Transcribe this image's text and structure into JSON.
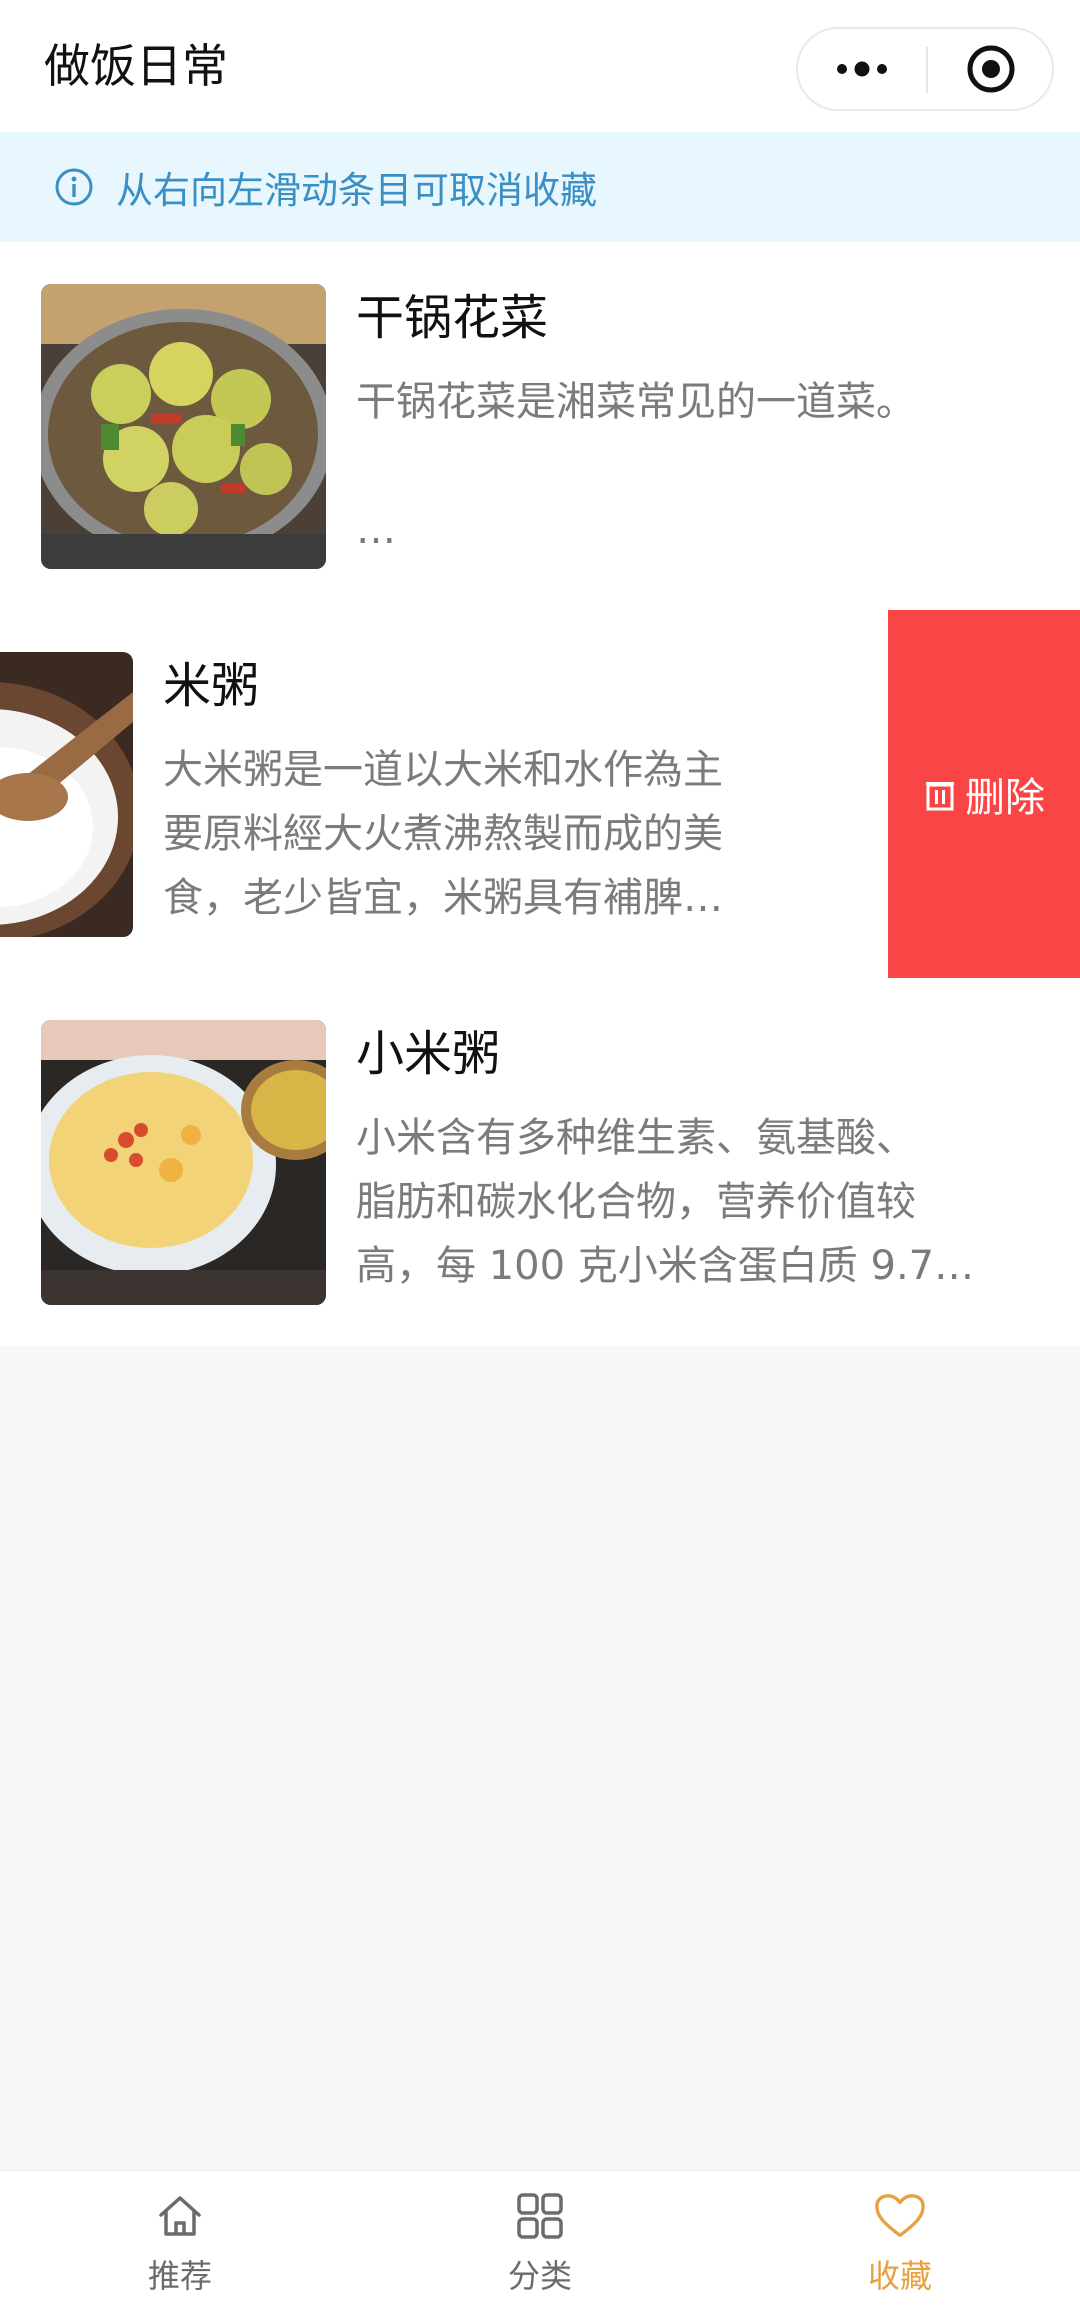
{
  "navbar": {
    "title": "做饭日常"
  },
  "notice": {
    "text": "从右向左滑动条目可取消收藏",
    "icon": "info-icon"
  },
  "favorites": [
    {
      "title": "干锅花菜",
      "desc_lines": [
        "干锅花菜是湘菜常见的一道菜。",
        "",
        "…"
      ]
    },
    {
      "title": "米粥",
      "desc_lines": [
        "大米粥是一道以大米和水作為主",
        "要原料經大火煮沸熬製而成的美",
        "食，老少皆宜，米粥具有補脾…"
      ],
      "swiped": true,
      "delete_label": "删除"
    },
    {
      "title": "小米粥",
      "desc_lines": [
        "小米含有多种维生素、氨基酸、",
        "脂肪和碳水化合物，营养价值较",
        "高，每 100 克小米含蛋白质 9.7…"
      ]
    }
  ],
  "tabbar": {
    "tabs": [
      {
        "label": "推荐",
        "icon": "home-icon",
        "active": false
      },
      {
        "label": "分类",
        "icon": "grid-icon",
        "active": false
      },
      {
        "label": "收藏",
        "icon": "heart-icon",
        "active": true
      }
    ]
  },
  "colors": {
    "accent": "#e8a040",
    "delete": "#fa4547",
    "notice_bg": "#e8f6fd",
    "notice_text": "#3a8fc4"
  }
}
